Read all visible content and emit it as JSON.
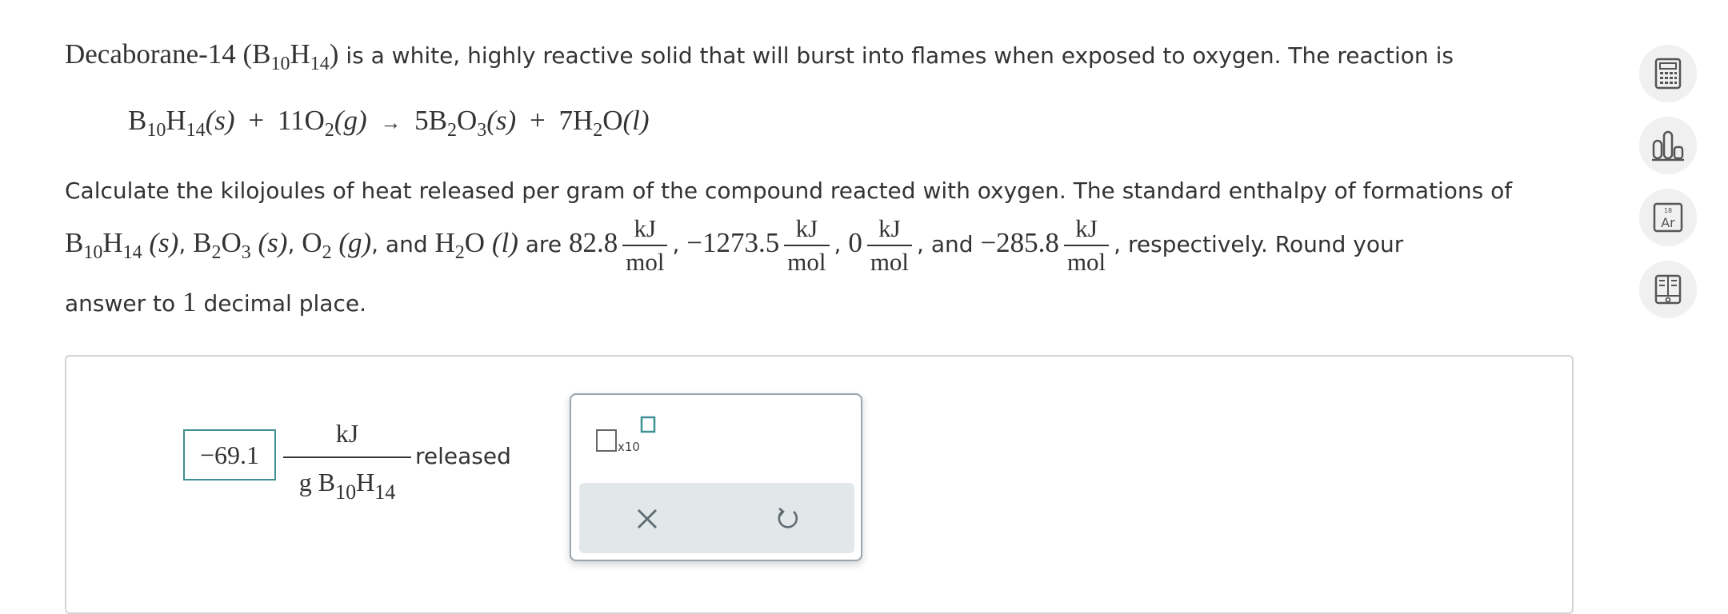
{
  "question": {
    "intro_compound": "Decaborane-14 (B",
    "intro_sub1": "10",
    "intro_h": "H",
    "intro_sub2": "14",
    "intro_close": ")",
    "intro_rest": " is a white, highly reactive solid that will burst into flames when exposed to oxygen. The reaction is",
    "equation": {
      "r1_B": "B",
      "r1_sub1": "10",
      "r1_H": "H",
      "r1_sub2": "14",
      "r1_state": "(s)",
      "plus1": "+",
      "r2_coef": "11",
      "r2_O": "O",
      "r2_sub": "2",
      "r2_state": "(g)",
      "arrow": "→",
      "p1_coef": "5",
      "p1_B": "B",
      "p1_sub1": "2",
      "p1_O": "O",
      "p1_sub2": "3",
      "p1_state": "(s)",
      "plus2": "+",
      "p2_coef": "7",
      "p2_H": "H",
      "p2_sub": "2",
      "p2_O": "O",
      "p2_state": "(l)"
    },
    "line3": "Calculate the kilojoules of heat released per gram of the compound reacted with oxygen. The standard enthalpy of formations of",
    "line4": {
      "s1_B": "B",
      "s1_sub1": "10",
      "s1_H": "H",
      "s1_sub2": "14",
      "s1_state": "(s)",
      "comma1": ", ",
      "s2_B": "B",
      "s2_sub1": "2",
      "s2_O": "O",
      "s2_sub2": "3",
      "s2_state": "(s)",
      "comma2": ", ",
      "s3_O": "O",
      "s3_sub": "2",
      "s3_state": "(g)",
      "and1": ", and ",
      "s4_H": "H",
      "s4_sub": "2",
      "s4_O": "O",
      "s4_state": "(l)",
      "are": " are ",
      "v1": "82.8",
      "v2": "−1273.5",
      "v3": "0",
      "v4": "−285.8",
      "unit_num": "kJ",
      "unit_den": "mol",
      "sep": ",",
      "and2": " and ",
      "respectively": ", respectively. Round your"
    },
    "line5_pre": "answer to ",
    "line5_num": "1",
    "line5_post": " decimal place."
  },
  "answer": {
    "value": "−69.1",
    "unit_num": "kJ",
    "unit_den_g": "g B",
    "unit_den_sub1": "10",
    "unit_den_H": "H",
    "unit_den_sub2": "14",
    "suffix": "released"
  },
  "palette": {
    "sci_label": "x10"
  },
  "toolbar": {
    "icons": [
      "calculator-icon",
      "bar-chart-icon",
      "periodic-table-icon",
      "textbook-icon"
    ],
    "periodic_number": "18",
    "periodic_symbol": "Ar"
  },
  "colors": {
    "accent": "#3f8f94",
    "palette_bg": "#e2e8ea",
    "tool_bg": "#f0f0f0"
  }
}
